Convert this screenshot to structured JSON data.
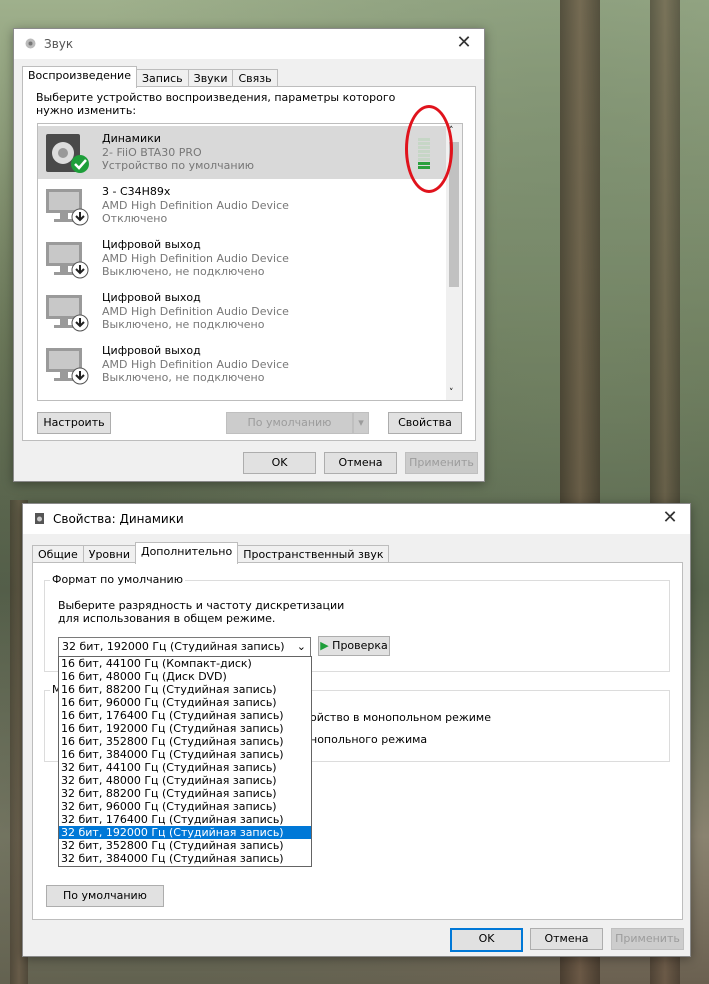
{
  "sound_dialog": {
    "title": "Звук",
    "tabs": [
      "Воспроизведение",
      "Запись",
      "Звуки",
      "Связь"
    ],
    "instruction": "Выберите устройство воспроизведения, параметры которого нужно изменить:",
    "devices": [
      {
        "name": "Динамики",
        "line1": "2- FiiO BTA30 PRO",
        "line2": "Устройство по умолчанию"
      },
      {
        "name": "3 - C34H89x",
        "line1": "AMD High Definition Audio Device",
        "line2": "Отключено"
      },
      {
        "name": "Цифровой выход",
        "line1": "AMD High Definition Audio Device",
        "line2": "Выключено, не подключено"
      },
      {
        "name": "Цифровой выход",
        "line1": "AMD High Definition Audio Device",
        "line2": "Выключено, не подключено"
      },
      {
        "name": "Цифровой выход",
        "line1": "AMD High Definition Audio Device",
        "line2": "Выключено, не подключено"
      }
    ],
    "buttons": {
      "configure": "Настроить",
      "set_default": "По умолчанию",
      "properties": "Свойства",
      "ok": "OK",
      "cancel": "Отмена",
      "apply": "Применить"
    }
  },
  "props_dialog": {
    "title": "Свойства: Динамики",
    "tabs": [
      "Общие",
      "Уровни",
      "Дополнительно",
      "Пространственный звук"
    ],
    "group_title": "Формат по умолчанию",
    "group_desc": "Выберите разрядность и частоту дискретизации для использования в общем режиме.",
    "selected_format": "32 бит, 192000 Гц (Студийная запись)",
    "test_button": "Проверка",
    "format_options": [
      "16 бит, 44100 Гц (Компакт-диск)",
      "16 бит, 48000 Гц (Диск DVD)",
      "16 бит, 88200 Гц (Студийная запись)",
      "16 бит, 96000 Гц (Студийная запись)",
      "16 бит, 176400 Гц (Студийная запись)",
      "16 бит, 192000 Гц (Студийная запись)",
      "16 бит, 352800 Гц (Студийная запись)",
      "16 бит, 384000 Гц (Студийная запись)",
      "32 бит, 44100 Гц (Студийная запись)",
      "32 бит, 48000 Гц (Студийная запись)",
      "32 бит, 88200 Гц (Студийная запись)",
      "32 бит, 96000 Гц (Студийная запись)",
      "32 бит, 176400 Гц (Студийная запись)",
      "32 бит, 192000 Гц (Студийная запись)",
      "32 бит, 352800 Гц (Студийная запись)",
      "32 бит, 384000 Гц (Студийная запись)"
    ],
    "selected_index": 13,
    "exclusive_group_letter": "М",
    "exclusive_line1_tail": "ойство в монопольном режиме",
    "exclusive_line2_tail": "нопольного режима",
    "restore_default": "По умолчанию",
    "ok": "OK",
    "cancel": "Отмена",
    "apply": "Применить"
  },
  "colors": {
    "accent": "#0078d7",
    "meter_on": "#2aa03c",
    "annotation": "#e0131c"
  }
}
